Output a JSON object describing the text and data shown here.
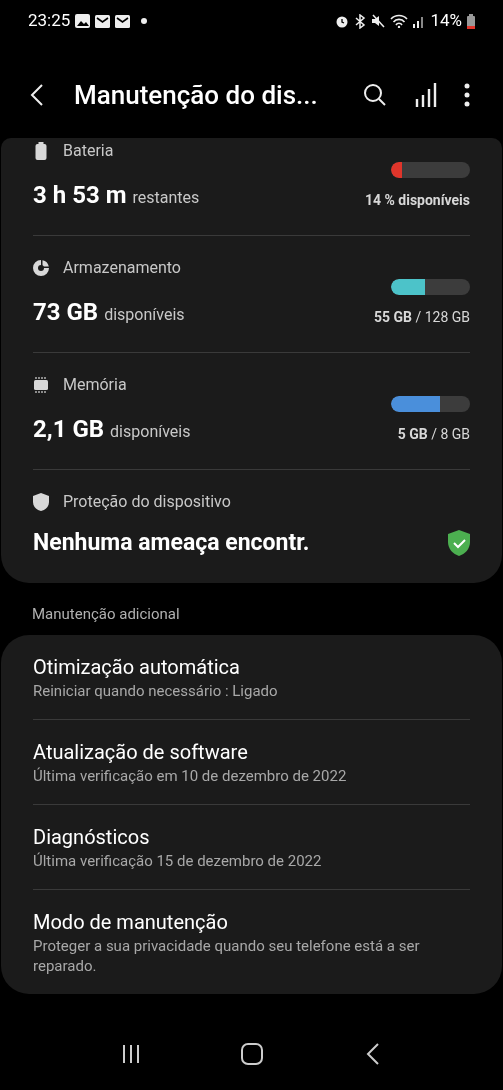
{
  "status_bar": {
    "time": "23:25",
    "battery": "14%"
  },
  "header": {
    "title": "Manutenção do dis..."
  },
  "stats": [
    {
      "kind": "battery",
      "label": "Bateria",
      "value": "3 h 53 m",
      "unit": "restantes",
      "level": 0.14,
      "color": "#e0352b",
      "reading": "**14 % disponíveis**"
    },
    {
      "kind": "storage",
      "label": "Armazenamento",
      "value": "73 GB",
      "unit": "disponíveis",
      "level": 0.43,
      "color": "#4cc3c9",
      "reading": "**55 GB** / 128 GB"
    },
    {
      "kind": "memory",
      "label": "Memória",
      "value": "2,1 GB",
      "unit": "disponíveis",
      "level": 0.62,
      "color": "#4a8fdb",
      "reading": "**5 GB** / 8 GB"
    }
  ],
  "protection": {
    "label": "Proteção do dispositivo",
    "status": "Nenhuma ameaça encontr."
  },
  "section_title": "Manutenção adicional",
  "items": [
    {
      "title": "Otimização automática",
      "subtitle": "Reiniciar quando necessário : Ligado"
    },
    {
      "title": "Atualização de software",
      "subtitle": "Última verificação em 10 de dezembro de 2022"
    },
    {
      "title": "Diagnósticos",
      "subtitle": "Última verificação 15 de dezembro de 2022"
    },
    {
      "title": "Modo de manutenção",
      "subtitle": "Proteger a sua privacidade quando seu telefone está a ser reparado."
    }
  ]
}
